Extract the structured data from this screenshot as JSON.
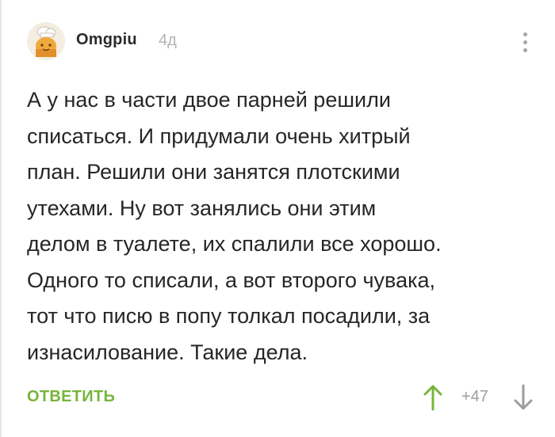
{
  "comment": {
    "author": "Omgpiu",
    "time": "4д",
    "avatar_icon": "chef-hat-avatar-icon",
    "lines": [
      "А у нас в части двое парней решили",
      "списаться. И придумали очень хитрый",
      "план. Решили они занятся плотскими",
      "утехами. Ну вот занялись они этим",
      "делом в туалете, их спалили все хорошо.",
      "Одного то списали, а вот второго чувака,",
      "тот что писю в попу толкал посадили, за",
      "изнасилование. Такие дела."
    ],
    "reply_label": "ОТВЕТИТЬ",
    "score": "+47"
  },
  "colors": {
    "accent": "#76b53a",
    "muted": "#9e9e9e",
    "text": "#262626"
  }
}
